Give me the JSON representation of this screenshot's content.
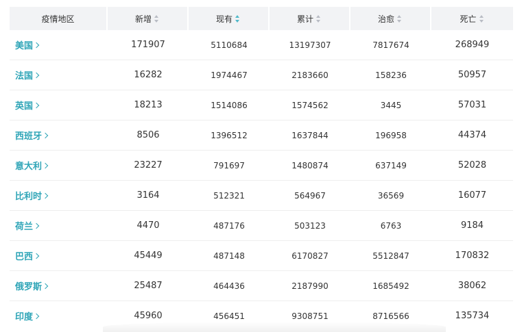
{
  "table": {
    "columns": [
      {
        "label": "疫情地区",
        "sortable": false
      },
      {
        "label": "新增",
        "sortable": true,
        "active": false
      },
      {
        "label": "现有",
        "sortable": true,
        "active": true
      },
      {
        "label": "累计",
        "sortable": true,
        "active": false
      },
      {
        "label": "治愈",
        "sortable": true,
        "active": false
      },
      {
        "label": "死亡",
        "sortable": true,
        "active": false
      }
    ],
    "rows": [
      {
        "region": "美国",
        "new": "171907",
        "current": "5110684",
        "total": "13197307",
        "cured": "7817674",
        "deaths": "268949"
      },
      {
        "region": "法国",
        "new": "16282",
        "current": "1974467",
        "total": "2183660",
        "cured": "158236",
        "deaths": "50957"
      },
      {
        "region": "英国",
        "new": "18213",
        "current": "1514086",
        "total": "1574562",
        "cured": "3445",
        "deaths": "57031"
      },
      {
        "region": "西班牙",
        "new": "8506",
        "current": "1396512",
        "total": "1637844",
        "cured": "196958",
        "deaths": "44374"
      },
      {
        "region": "意大利",
        "new": "23227",
        "current": "791697",
        "total": "1480874",
        "cured": "637149",
        "deaths": "52028"
      },
      {
        "region": "比利时",
        "new": "3164",
        "current": "512321",
        "total": "564967",
        "cured": "36569",
        "deaths": "16077"
      },
      {
        "region": "荷兰",
        "new": "4470",
        "current": "487176",
        "total": "503123",
        "cured": "6763",
        "deaths": "9184"
      },
      {
        "region": "巴西",
        "new": "45449",
        "current": "487148",
        "total": "6170827",
        "cured": "5512847",
        "deaths": "170832"
      },
      {
        "region": "俄罗斯",
        "new": "25487",
        "current": "464436",
        "total": "2187990",
        "cured": "1685492",
        "deaths": "38062"
      },
      {
        "region": "印度",
        "new": "45960",
        "current": "456451",
        "total": "9308751",
        "cured": "8716566",
        "deaths": "135734"
      }
    ]
  },
  "colors": {
    "accent": "#2fa5b7",
    "header_bg": "#f2f3f5",
    "sort_active": "#4fb9c9",
    "sort_inactive": "#b9bcc4"
  },
  "icons": {
    "sort": "sort-caret-icon",
    "region_link": "chevron-right-icon"
  }
}
